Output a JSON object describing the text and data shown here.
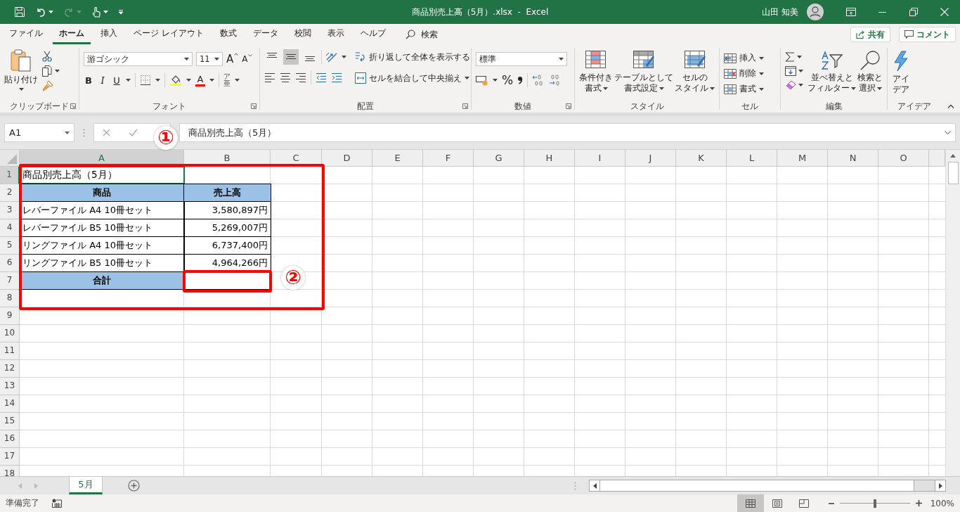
{
  "title_bar": {
    "title": "商品別売上高（5月）.xlsx  -  Excel",
    "user": "山田 知美"
  },
  "menu_tabs": [
    {
      "label": "ファイル",
      "selected": false
    },
    {
      "label": "ホーム",
      "selected": true
    },
    {
      "label": "挿入",
      "selected": false
    },
    {
      "label": "ページ レイアウト",
      "selected": false
    },
    {
      "label": "数式",
      "selected": false
    },
    {
      "label": "データ",
      "selected": false
    },
    {
      "label": "校閲",
      "selected": false
    },
    {
      "label": "表示",
      "selected": false
    },
    {
      "label": "ヘルプ",
      "selected": false
    }
  ],
  "search": {
    "label": "検索"
  },
  "share_button": "共有",
  "comment_button": "コメント",
  "ribbon": {
    "clipboard": {
      "label": "クリップボード",
      "paste": "貼り付け"
    },
    "font": {
      "label": "フォント",
      "font_name": "游ゴシック",
      "font_size": "11",
      "grow": "A",
      "shrink": "A",
      "bold": "B",
      "italic": "I",
      "underline": "U",
      "font_color": "A",
      "phonetic": [
        "ア",
        "亜"
      ]
    },
    "alignment": {
      "label": "配置",
      "vertical": [
        {
          "selected": false
        },
        {
          "selected": true
        },
        {
          "selected": false
        }
      ],
      "wrap": "折り返して全体を表示する",
      "merge": "セルを結合して中央揃え"
    },
    "number": {
      "label": "数値",
      "format": "標準",
      "percent": "%"
    },
    "styles": {
      "label": "スタイル",
      "buttons": [
        {
          "lines": [
            "条件付き",
            "書式"
          ]
        },
        {
          "lines": [
            "テーブルとして",
            "書式設定"
          ]
        },
        {
          "lines": [
            "セルの",
            "スタイル"
          ]
        }
      ]
    },
    "cells": {
      "label": "セル",
      "buttons": [
        "挿入",
        "削除",
        "書式"
      ]
    },
    "editing": {
      "label": "編集",
      "buttons": [
        {
          "lines": [
            "並べ替えと",
            "フィルター"
          ]
        },
        {
          "lines": [
            "検索と",
            "選択"
          ]
        }
      ]
    },
    "ideas": {
      "label": "アイデア",
      "lines": [
        "アイ",
        "デア"
      ]
    }
  },
  "formula_bar": {
    "name_box": "A1",
    "content": "商品別売上高（5月）"
  },
  "sheet": {
    "columns": [
      {
        "label": "A",
        "selected": true
      },
      {
        "label": "B",
        "selected": false
      },
      {
        "label": "C",
        "selected": false
      },
      {
        "label": "D",
        "selected": false
      },
      {
        "label": "E",
        "selected": false
      },
      {
        "label": "F",
        "selected": false
      },
      {
        "label": "G",
        "selected": false
      },
      {
        "label": "H",
        "selected": false
      },
      {
        "label": "I",
        "selected": false
      },
      {
        "label": "J",
        "selected": false
      },
      {
        "label": "K",
        "selected": false
      },
      {
        "label": "L",
        "selected": false
      },
      {
        "label": "M",
        "selected": false
      },
      {
        "label": "N",
        "selected": false
      },
      {
        "label": "O",
        "selected": false
      }
    ],
    "rows": [
      {
        "number": "1",
        "selected": true,
        "cells": [
          {
            "kind": "title",
            "text": "商品別売上高（5月）",
            "selected": true
          },
          {
            "kind": "plain",
            "selected": false
          }
        ]
      },
      {
        "number": "2",
        "selected": false,
        "cells": [
          {
            "kind": "header",
            "text": "商品",
            "selected": false
          },
          {
            "kind": "header",
            "text": "売上高",
            "selected": false
          }
        ]
      },
      {
        "number": "3",
        "selected": false,
        "cells": [
          {
            "kind": "item",
            "text": "レバーファイル A4 10冊セット",
            "selected": false
          },
          {
            "kind": "amount",
            "text": "3,580,897円",
            "selected": false
          }
        ]
      },
      {
        "number": "4",
        "selected": false,
        "cells": [
          {
            "kind": "item",
            "text": "レバーファイル B5 10冊セット",
            "selected": false
          },
          {
            "kind": "amount",
            "text": "5,269,007円",
            "selected": false
          }
        ]
      },
      {
        "number": "5",
        "selected": false,
        "cells": [
          {
            "kind": "item",
            "text": "リングファイル A4 10冊セット",
            "selected": false
          },
          {
            "kind": "amount",
            "text": "6,737,400円",
            "selected": false
          }
        ]
      },
      {
        "number": "6",
        "selected": false,
        "cells": [
          {
            "kind": "item",
            "text": "リングファイル B5 10冊セット",
            "selected": false
          },
          {
            "kind": "amount",
            "text": "4,964,266円",
            "selected": false
          }
        ]
      },
      {
        "number": "7",
        "selected": false,
        "cells": [
          {
            "kind": "header",
            "text": "合計",
            "selected": false
          },
          {
            "kind": "amount",
            "selected": false
          }
        ]
      },
      {
        "number": "8",
        "selected": false,
        "cells": []
      },
      {
        "number": "9",
        "selected": false,
        "cells": []
      },
      {
        "number": "10",
        "selected": false,
        "cells": []
      },
      {
        "number": "11",
        "selected": false,
        "cells": []
      },
      {
        "number": "12",
        "selected": false,
        "cells": []
      },
      {
        "number": "13",
        "selected": false,
        "cells": []
      },
      {
        "number": "14",
        "selected": false,
        "cells": []
      },
      {
        "number": "15",
        "selected": false,
        "cells": []
      },
      {
        "number": "16",
        "selected": false,
        "cells": []
      },
      {
        "number": "17",
        "selected": false,
        "cells": []
      },
      {
        "number": "18",
        "selected": false,
        "cells": []
      }
    ]
  },
  "annotations": [
    {
      "label": "①"
    },
    {
      "label": "②"
    }
  ],
  "sheet_tabs": [
    {
      "label": "5月",
      "selected": true
    }
  ],
  "status_bar": {
    "status": "準備完了",
    "views": [
      {
        "selected": true
      },
      {
        "selected": false
      },
      {
        "selected": false
      }
    ],
    "zoom": {
      "level": 0.5,
      "reading": "100%"
    }
  }
}
